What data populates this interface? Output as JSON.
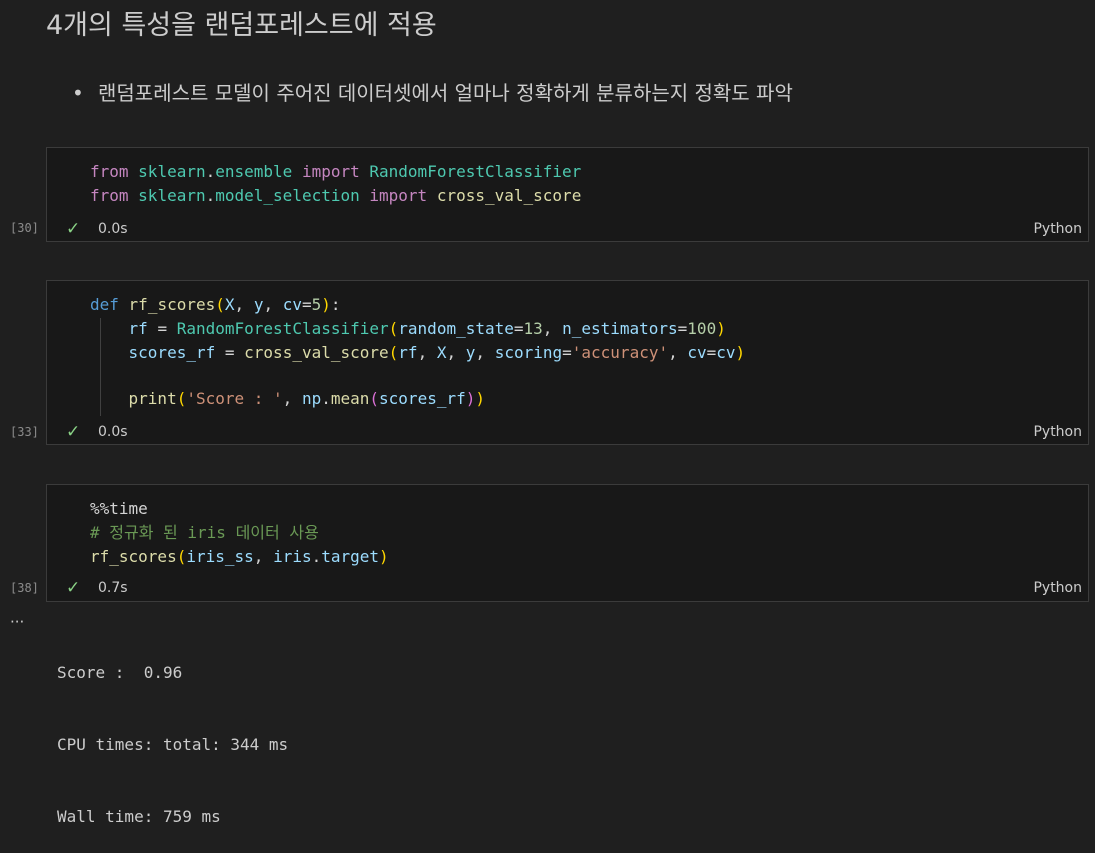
{
  "markdown": {
    "heading": "4개의 특성을 랜덤포레스트에 적용",
    "bullet": "•",
    "list_item": "랜덤포레스트 모델이 주어진 데이터셋에서 얼마나 정확하게 분류하는지 정확도 파악"
  },
  "cells": [
    {
      "exec_count": "[30]",
      "status_icon": "check-icon",
      "exec_time": "0.0s",
      "language": "Python",
      "code": [
        "from sklearn.ensemble import RandomForestClassifier",
        "from sklearn.model_selection import cross_val_score"
      ]
    },
    {
      "exec_count": "[33]",
      "status_icon": "check-icon",
      "exec_time": "0.0s",
      "language": "Python",
      "code": [
        "def rf_scores(X, y, cv=5):",
        "    rf = RandomForestClassifier(random_state=13, n_estimators=100)",
        "    scores_rf = cross_val_score(rf, X, y, scoring='accuracy', cv=cv)",
        "",
        "    print('Score : ', np.mean(scores_rf))"
      ]
    },
    {
      "exec_count": "[38]",
      "status_icon": "check-icon",
      "exec_time": "0.7s",
      "language": "Python",
      "code": [
        "%%time",
        "# 정규화 된 iris 데이터 사용",
        "rf_scores(iris_ss, iris.target)"
      ]
    }
  ],
  "output": {
    "more_label": "···",
    "lines": [
      "Score :  0.96",
      "CPU times: total: 344 ms",
      "Wall time: 759 ms"
    ]
  },
  "colors": {
    "background": "#1f1f1f",
    "cell_background": "#181818",
    "success_check": "#89d185",
    "keyword_control": "#c586c0",
    "keyword_def": "#569cd6",
    "class_name": "#4ec9b0",
    "function_name": "#dcdcaa",
    "variable": "#9cdcfe",
    "number": "#b5cea8",
    "string": "#ce9178",
    "comment": "#6a9955"
  }
}
